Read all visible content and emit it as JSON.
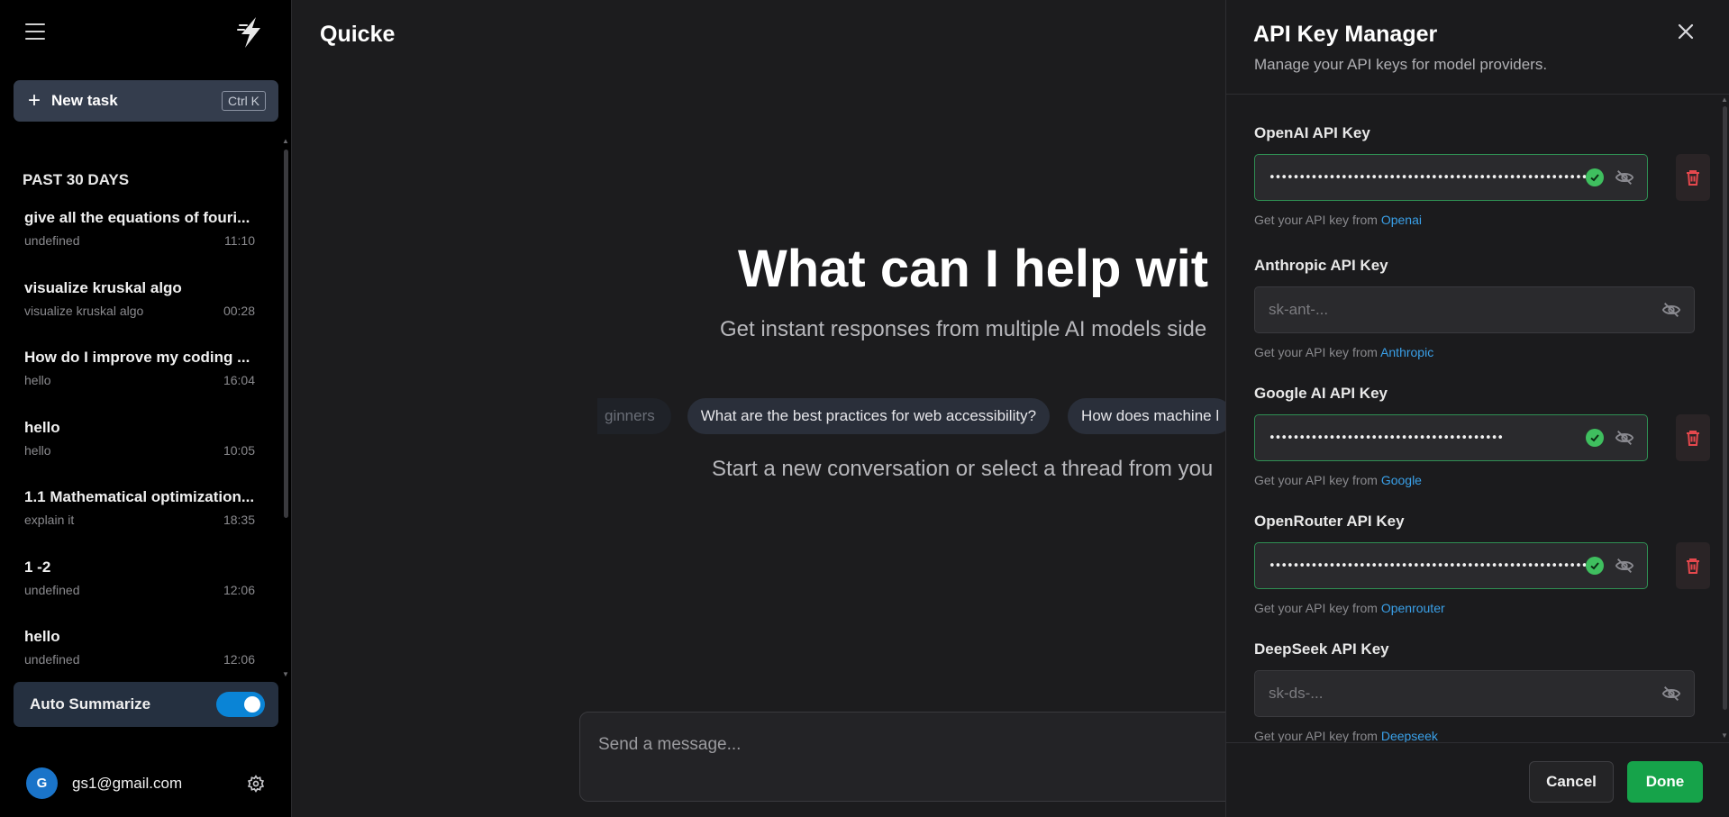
{
  "sidebar": {
    "menu_icon": "hamburger-icon",
    "logo_icon": "lightning-logo",
    "new_task": {
      "label": "New task",
      "shortcut": "Ctrl K"
    },
    "section_title": "PAST 30 DAYS",
    "threads": [
      {
        "title": "give all the equations of fouri...",
        "subtitle": "undefined",
        "time": "11:10"
      },
      {
        "title": "visualize kruskal algo",
        "subtitle": "visualize kruskal algo",
        "time": "00:28"
      },
      {
        "title": "How do I improve my coding ...",
        "subtitle": "hello",
        "time": "16:04"
      },
      {
        "title": "hello",
        "subtitle": "hello",
        "time": "10:05"
      },
      {
        "title": "1.1 Mathematical optimization...",
        "subtitle": "explain it",
        "time": "18:35"
      },
      {
        "title": "1 -2",
        "subtitle": "undefined",
        "time": "12:06"
      },
      {
        "title": "hello",
        "subtitle": "undefined",
        "time": "12:06"
      }
    ],
    "auto_summarize": {
      "label": "Auto Summarize",
      "enabled": true
    },
    "user": {
      "avatar_letter": "G",
      "email": "gs1@gmail.com"
    }
  },
  "main": {
    "brand": "Quicke",
    "hero": "What can I help wit",
    "subtitle": "Get instant responses from multiple AI models side",
    "chips": [
      "ginners",
      "What are the best practices for web accessibility?",
      "How does machine l"
    ],
    "hint": "Start a new conversation or select a thread from you",
    "composer_placeholder": "Send a message..."
  },
  "panel": {
    "title": "API Key Manager",
    "subtitle": "Manage your API keys for model providers.",
    "help_prefix": "Get your API key from",
    "keys": [
      {
        "label": "OpenAI API Key",
        "masked": "•••••••••••••••••••••••••••••••••••••••••••••••••••••••••••••••••",
        "set": true,
        "link": "Openai"
      },
      {
        "label": "Anthropic API Key",
        "placeholder": "sk-ant-...",
        "set": false,
        "link": "Anthropic"
      },
      {
        "label": "Google AI API Key",
        "masked": "•••••••••••••••••••••••••••••••••••••••",
        "set": true,
        "link": "Google"
      },
      {
        "label": "OpenRouter API Key",
        "masked": "•••••••••••••••••••••••••••••••••••••••••••••••••••••••••••••••••",
        "set": true,
        "link": "Openrouter"
      },
      {
        "label": "DeepSeek API Key",
        "placeholder": "sk-ds-...",
        "set": false,
        "link": "Deepseek"
      }
    ],
    "cancel_label": "Cancel",
    "done_label": "Done"
  },
  "colors": {
    "accent": "#0a84d6",
    "success": "#16a34a",
    "danger": "#e5484d",
    "link": "#3aa0e8"
  }
}
